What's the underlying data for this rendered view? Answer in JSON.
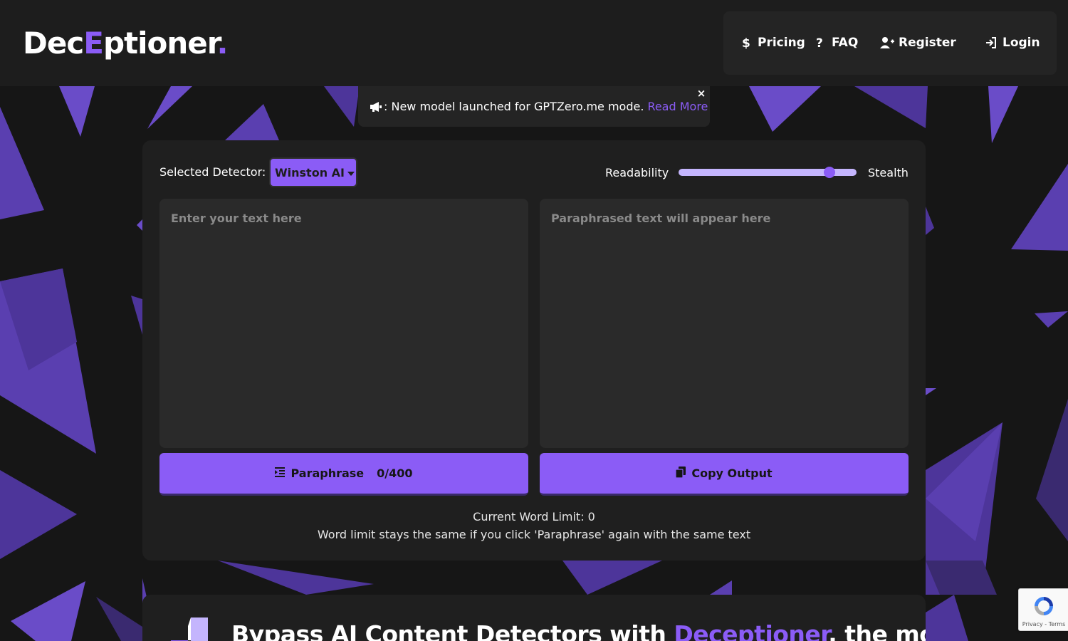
{
  "header": {
    "logo_part1": "Dec",
    "logo_accent": "E",
    "logo_part2": "ptioner",
    "logo_dot": ".",
    "nav": {
      "pricing": "Pricing",
      "faq": "FAQ",
      "register": "Register",
      "login": "Login"
    }
  },
  "announcement": {
    "text": ": New model launched for GPTZero.me mode.",
    "link": "Read More",
    "close": "×"
  },
  "panel": {
    "detector_label": "Selected Detector:",
    "detector_value": "Winston AI",
    "slider": {
      "left_label": "Readability",
      "right_label": "Stealth",
      "level": 0.87
    },
    "input_placeholder": "Enter your text here",
    "output_placeholder": "Paraphrased text will appear here",
    "paraphrase_label": "Paraphrase",
    "paraphrase_count": "0/400",
    "copy_label": "Copy Output",
    "word_limit": "Current Word Limit: 0",
    "word_note": "Word limit stays the same if you click 'Paraphrase' again with the same text"
  },
  "bottom": {
    "heading_part1": "Bypass AI Content Detectors with ",
    "heading_accent": "Deceptioner",
    "heading_part2": ", the most"
  },
  "recaptcha": {
    "terms": "Privacy - Terms"
  },
  "colors": {
    "accent": "#8b5cf6",
    "background": "#161616",
    "panel": "#1f1f1f"
  }
}
